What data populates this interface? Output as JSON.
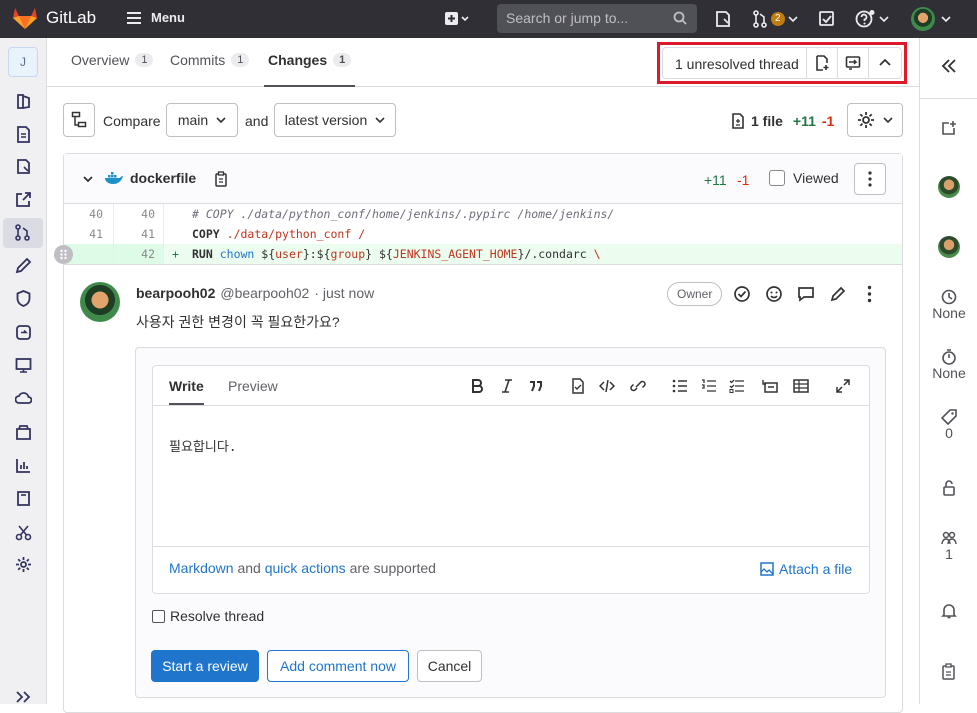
{
  "topbar": {
    "brand": "GitLab",
    "menu_label": "Menu",
    "search_placeholder": "Search or jump to...",
    "mr_count": "2"
  },
  "sidebar": {
    "project_initial": "J",
    "icons": [
      "project-overview-icon",
      "repository-icon",
      "issues-icon",
      "external-link-icon",
      "merge-requests-icon",
      "ci-cd-icon",
      "security-icon",
      "deployments-icon",
      "monitor-icon",
      "infrastructure-icon",
      "packages-icon",
      "analytics-icon",
      "wiki-icon",
      "snippets-icon",
      "settings-icon"
    ]
  },
  "tabs": [
    {
      "label": "Overview",
      "count": "1"
    },
    {
      "label": "Commits",
      "count": "1"
    },
    {
      "label": "Changes",
      "count": "1"
    }
  ],
  "threads": {
    "label": "1 unresolved thread"
  },
  "compare": {
    "compare_label": "Compare",
    "base_branch": "main",
    "and_label": "and",
    "target_version": "latest version",
    "files_count": "1 file",
    "added": "+11",
    "removed": "-1"
  },
  "file": {
    "name": "dockerfile",
    "added": "+11",
    "removed": "-1",
    "viewed_label": "Viewed"
  },
  "diff_lines": [
    {
      "old": "40",
      "new": "40",
      "text": "# COPY ./data/python_conf/home/jenkins/.pypirc /home/jenkins/"
    },
    {
      "old": "41",
      "new": "41",
      "text": "COPY ./data/python_conf /"
    },
    {
      "old": "",
      "new": "42",
      "text": "RUN chown ${user}:${group} ${JENKINS_AGENT_HOME}/.condarc \\"
    }
  ],
  "comment": {
    "author": "bearpooh02",
    "handle": "@bearpooh02",
    "time": "· just now",
    "role": "Owner",
    "body": "사용자 권한 변경이 꼭 필요한가요?"
  },
  "reply": {
    "tab_write": "Write",
    "tab_preview": "Preview",
    "text": "필요합니다.",
    "markdown_link": "Markdown",
    "and_text": "and",
    "quick_actions_link": "quick actions",
    "supported_text": "are supported",
    "attach_label": "Attach a file",
    "resolve_label": "Resolve thread",
    "start_review": "Start a review",
    "add_comment": "Add comment now",
    "cancel": "Cancel"
  },
  "right_sidebar": {
    "assignee": "None",
    "time_tracking": "None",
    "labels_count": "0",
    "participants": "1"
  },
  "colors": {
    "topbar": "#2f2f35",
    "primary": "#1f75cb",
    "added": "#217645",
    "removed": "#dd2b0e",
    "highlight": "#dd1a2a"
  }
}
